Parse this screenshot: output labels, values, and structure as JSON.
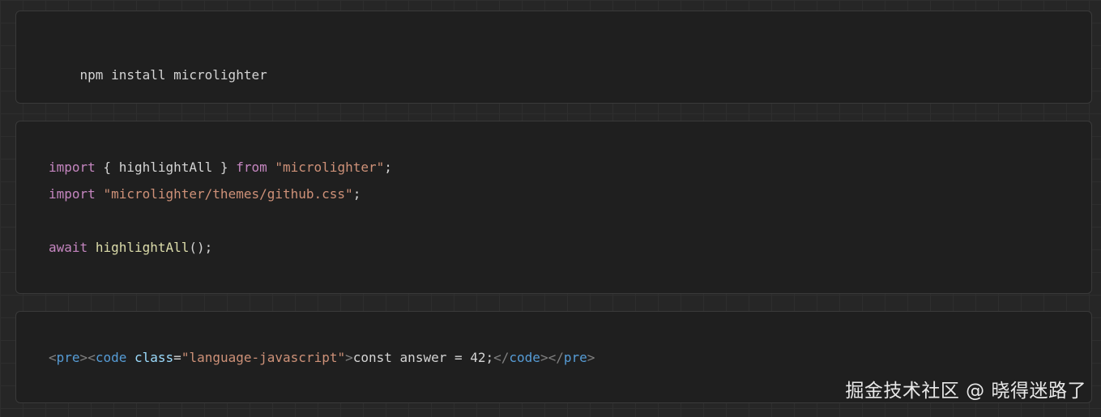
{
  "blocks": {
    "install": {
      "line1": "npm install microlighter"
    },
    "usage": {
      "line1": {
        "kw_import": "import",
        "brace_open": " { ",
        "name": "highlightAll",
        "brace_close": " } ",
        "kw_from": "from",
        "space": " ",
        "module": "\"microlighter\"",
        "semi": ";"
      },
      "line2": {
        "kw_import": "import",
        "space": " ",
        "path": "\"microlighter/themes/github.css\"",
        "semi": ";"
      },
      "line3": {
        "kw_await": "await",
        "space": " ",
        "func": "highlightAll",
        "tail": "();"
      }
    },
    "html_example": {
      "lt1": "<",
      "tag_pre": "pre",
      "gt1": ">",
      "lt2": "<",
      "tag_code": "code",
      "space": " ",
      "attr": "class",
      "eq": "=",
      "attr_value": "\"language-javascript\"",
      "gt2": ">",
      "content": "const answer = 42;",
      "lt3": "</",
      "tag_code_close": "code",
      "gt3": ">",
      "lt4": "</",
      "tag_pre_close": "pre",
      "gt4": ">"
    }
  },
  "watermark": "掘金技术社区 @ 晓得迷路了",
  "colors": {
    "background": "#262626",
    "block_background": "#1f1f1f",
    "block_border": "#3a3a3a",
    "text": "#d4d4d4",
    "keyword": "#c586c0",
    "string": "#ce9178",
    "function": "#dcdcaa",
    "tag": "#569cd6",
    "attribute": "#9cdcfe"
  }
}
